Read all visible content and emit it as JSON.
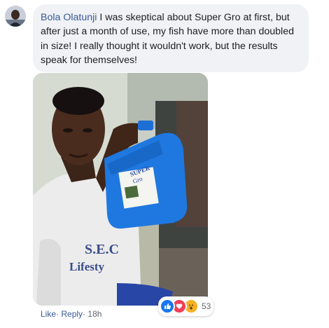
{
  "comment": {
    "author": "Bola Olatunji",
    "text": "I was skeptical about Super Gro at first, but after just a month of use, my fish have more than doubled in size! I really thought it wouldn't work, but the results speak for themselves!"
  },
  "photo": {
    "jug_label_line1": "SUPER",
    "jug_label_line2": "Gro",
    "shirt_text_line1": "S.E.C",
    "shirt_text_line2": "Lifesty"
  },
  "actions": {
    "like": "Like",
    "separator": "·",
    "reply": "Reply",
    "time": "18h"
  },
  "reactions": {
    "types": [
      "like-icon",
      "love-icon",
      "wow-icon"
    ],
    "count": "53"
  },
  "colors": {
    "link": "#385898",
    "bubble": "#f0f2f5",
    "like": "#1877f2",
    "love": "#f33e58",
    "wow": "#f7b125"
  }
}
